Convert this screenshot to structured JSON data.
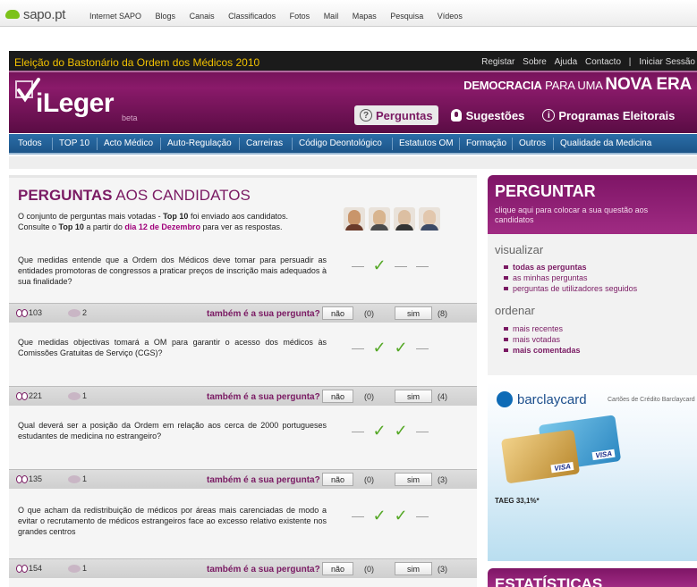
{
  "sapo": {
    "logo": "sapo.pt",
    "nav": [
      "Internet SAPO",
      "Blogs",
      "Canais",
      "Classificados",
      "Fotos",
      "Mail",
      "Mapas",
      "Pesquisa",
      "Vídeos"
    ]
  },
  "header": {
    "title": "Eleição do Bastonário da Ordem dos Médicos 2010",
    "links": [
      "Registar",
      "Sobre",
      "Ajuda",
      "Contacto",
      "|",
      "Iniciar Sessão"
    ],
    "brand": "iLeger",
    "beta": "beta",
    "slogan": {
      "bold1": "DEMOCRACIA",
      "light": " PARA UMA ",
      "bold2": "NOVA ERA"
    },
    "tabs": [
      {
        "icon": "?",
        "label": "Perguntas"
      },
      {
        "icon": "",
        "label": "Sugestões"
      },
      {
        "icon": "i",
        "label": "Programas Eleitorais"
      }
    ]
  },
  "categories": [
    "Todos",
    "TOP 10",
    "Acto Médico",
    "Auto-Regulação",
    "Carreiras",
    "Código Deontológico",
    "Estatutos OM",
    "Formação",
    "Outros",
    "Qualidade da Medicina"
  ],
  "main": {
    "heading_bold": "PERGUNTAS",
    "heading_rest": " AOS CANDIDATOS",
    "intro": {
      "t1": "O conjunto de perguntas mais votadas - ",
      "b1": "Top 10",
      "t2": " foi enviado aos candidatos.",
      "t3": "Consulte o ",
      "b2": "Top 10",
      "t4": " a partir do ",
      "b3": "dia 12 de Dezembro",
      "t5": " para ver as respostas."
    },
    "also_label": "também é a sua pergunta?",
    "btn_no": "não",
    "btn_yes": "sim",
    "questions": [
      {
        "text": "Que medidas entende que a Ordem dos Médicos deve tomar para persuadir as entidades promotoras de congressos a praticar preços de inscrição mais adequados à sua finalidade?",
        "marks": [
          "—",
          "✓",
          "—",
          "—"
        ],
        "views": "103",
        "comments": "2",
        "no": "(0)",
        "yes": "(8)"
      },
      {
        "text": "Que medidas objectivas tomará a OM para garantir o acesso dos médicos às Comissões Gratuitas de Serviço (CGS)?",
        "marks": [
          "—",
          "✓",
          "✓",
          "—"
        ],
        "views": "221",
        "comments": "1",
        "no": "(0)",
        "yes": "(4)"
      },
      {
        "text": "Qual deverá ser a posição da Ordem em relação aos cerca de 2000 portugueses estudantes de medicina no estrangeiro?",
        "marks": [
          "—",
          "✓",
          "✓",
          "—"
        ],
        "views": "135",
        "comments": "1",
        "no": "(0)",
        "yes": "(3)"
      },
      {
        "text": "O que acham da redistribuição de médicos por áreas mais carenciadas de modo a evitar o recrutamento de médicos estrangeiros face ao excesso relativo existente nos grandes centros",
        "marks": [
          "—",
          "✓",
          "✓",
          "—"
        ],
        "views": "154",
        "comments": "1",
        "no": "(0)",
        "yes": "(3)"
      }
    ]
  },
  "sidebar": {
    "ask_title": "PERGUNTAR",
    "ask_sub": "clique aqui para colocar a sua questão aos candidatos",
    "view_heading": "visualizar",
    "view_items": [
      "todas as perguntas",
      "as minhas perguntas",
      "perguntas de utilizadores seguidos"
    ],
    "order_heading": "ordenar",
    "order_items": [
      "mais recentes",
      "mais votadas",
      "mais comentadas"
    ],
    "ad_brand": "barclaycard",
    "ad_tagline": "Cartões de Crédito Barclaycard",
    "ad_card_label": "VISA",
    "ad_taeg": "TAEG 33,1%*",
    "stats_title": "ESTATÍSTICAS"
  }
}
